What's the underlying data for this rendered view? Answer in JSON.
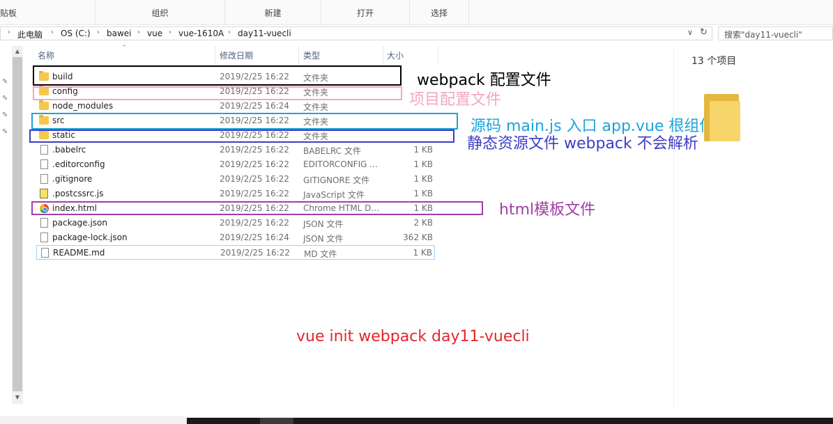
{
  "ribbon": {
    "groups": [
      "贴板",
      "组织",
      "新建",
      "打开",
      "选择"
    ]
  },
  "address": {
    "crumbs": [
      "此电脑",
      "OS (C:)",
      "bawei",
      "vue",
      "vue-1610A",
      "day11-vuecli"
    ],
    "search_placeholder": "搜索\"day11-vuecli\""
  },
  "columns": {
    "name": "名称",
    "date": "修改日期",
    "type": "类型",
    "size": "大小"
  },
  "files": [
    {
      "name": "build",
      "date": "2019/2/25 16:22",
      "type": "文件夹",
      "size": "",
      "icon": "folder"
    },
    {
      "name": "config",
      "date": "2019/2/25 16:22",
      "type": "文件夹",
      "size": "",
      "icon": "folder"
    },
    {
      "name": "node_modules",
      "date": "2019/2/25 16:24",
      "type": "文件夹",
      "size": "",
      "icon": "folder"
    },
    {
      "name": "src",
      "date": "2019/2/25 16:22",
      "type": "文件夹",
      "size": "",
      "icon": "folder"
    },
    {
      "name": "static",
      "date": "2019/2/25 16:22",
      "type": "文件夹",
      "size": "",
      "icon": "folder"
    },
    {
      "name": ".babelrc",
      "date": "2019/2/25 16:22",
      "type": "BABELRC 文件",
      "size": "1 KB",
      "icon": "file"
    },
    {
      "name": ".editorconfig",
      "date": "2019/2/25 16:22",
      "type": "EDITORCONFIG ...",
      "size": "1 KB",
      "icon": "file"
    },
    {
      "name": ".gitignore",
      "date": "2019/2/25 16:22",
      "type": "GITIGNORE 文件",
      "size": "1 KB",
      "icon": "file"
    },
    {
      "name": ".postcssrc.js",
      "date": "2019/2/25 16:22",
      "type": "JavaScript 文件",
      "size": "1 KB",
      "icon": "js"
    },
    {
      "name": "index.html",
      "date": "2019/2/25 16:22",
      "type": "Chrome HTML D...",
      "size": "1 KB",
      "icon": "chrome"
    },
    {
      "name": "package.json",
      "date": "2019/2/25 16:22",
      "type": "JSON 文件",
      "size": "2 KB",
      "icon": "file"
    },
    {
      "name": "package-lock.json",
      "date": "2019/2/25 16:24",
      "type": "JSON 文件",
      "size": "362 KB",
      "icon": "file"
    },
    {
      "name": "README.md",
      "date": "2019/2/25 16:22",
      "type": "MD 文件",
      "size": "1 KB",
      "icon": "file"
    }
  ],
  "details": {
    "item_count": "13 个项目"
  },
  "annotations": {
    "build": {
      "text": "webpack 配置文件",
      "color": "#000000"
    },
    "config": {
      "text": "项目配置文件",
      "color": "#f4a6c0"
    },
    "src": {
      "text": "源码 main.js 入口 app.vue 根组件",
      "color": "#1ca3d9"
    },
    "static": {
      "text": "静态资源文件 webpack 不会解析",
      "color": "#3c3cc8"
    },
    "index": {
      "text": "html模板文件",
      "color": "#a23ea6"
    },
    "command": {
      "text": "vue init webpack day11-vuecli",
      "color": "#e3262d"
    }
  }
}
